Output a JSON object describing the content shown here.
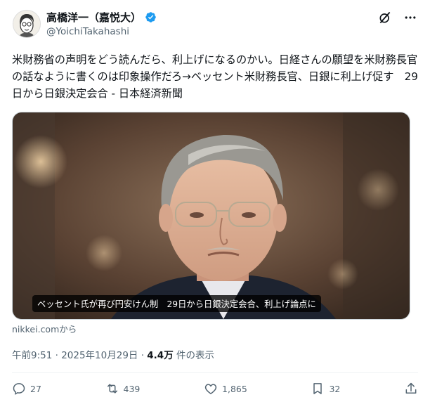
{
  "author": {
    "name": "高橋洋一（嘉悦大）",
    "handle": "@YoichiTakahashi",
    "verified_color": "#1d9bf0"
  },
  "post": {
    "text": "米財務省の声明をどう読んだら、利上げになるのかい。日経さんの願望を米財務長官の話なように書くのは印象操作だろ→ベッセント米財務長官、日銀に利上げ促す　29日から日銀決定会合 - 日本経済新聞"
  },
  "link_card": {
    "caption": "ベッセント氏が再び円安けん制　29日から日銀決定会合、利上げ論点に",
    "source": "nikkei.comから"
  },
  "meta": {
    "time": "午前9:51 · 2025年10月29日 · ",
    "views_count": "4.4万",
    "views_label": " 件の表示"
  },
  "actions": {
    "replies": "27",
    "reposts": "439",
    "likes": "1,865",
    "bookmarks": "32"
  }
}
